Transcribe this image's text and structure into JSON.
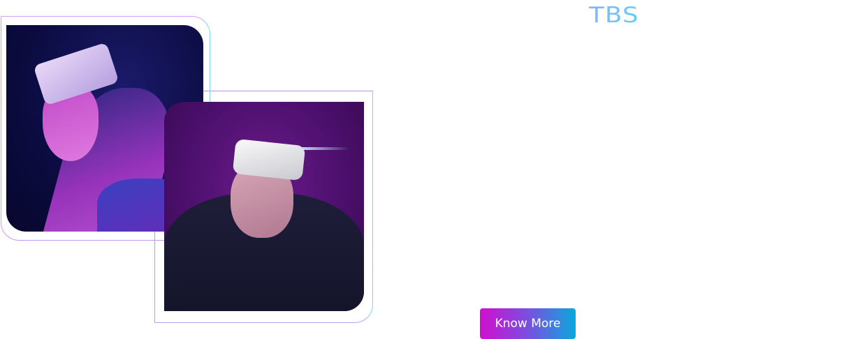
{
  "brand": {
    "logo_text": "TBS",
    "colors": [
      "#8ab4f8",
      "#5fd0f5"
    ]
  },
  "gallery": {
    "images": [
      {
        "description_icon": "vr-headset-woman-profile-photo"
      },
      {
        "description_icon": "vr-headset-woman-laughing-photo"
      }
    ],
    "frame_colors": [
      "#ee7fe6",
      "#7fd6f2"
    ]
  },
  "cta": {
    "label": "Know More",
    "gradient": [
      "#d00fcf",
      "#0aa8dc"
    ]
  }
}
